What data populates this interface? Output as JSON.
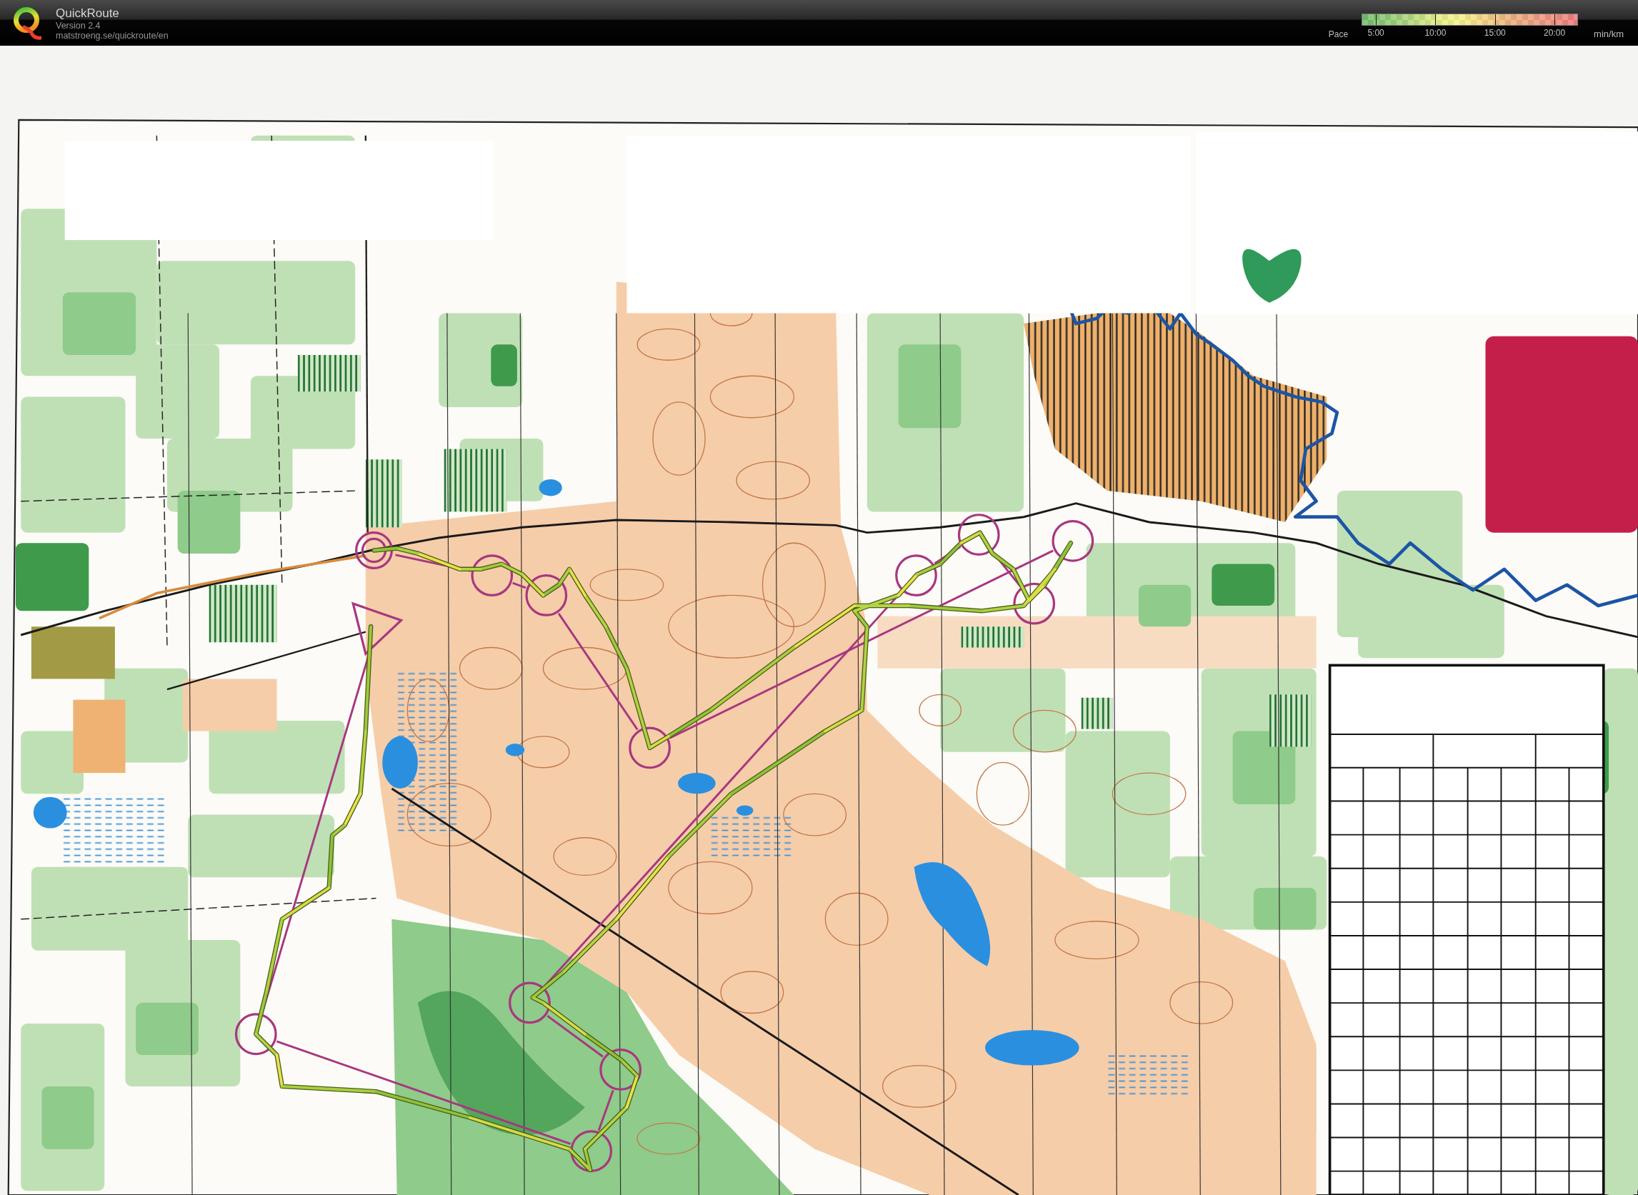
{
  "app": {
    "title": "QuickRoute",
    "version": "Version 2.4",
    "url": "matstroeng.se/quickroute/en"
  },
  "pace_legend": {
    "label": "Pace",
    "ticks": [
      "5:00",
      "10:00",
      "15:00",
      "20:00"
    ],
    "unit": "min/km"
  }
}
